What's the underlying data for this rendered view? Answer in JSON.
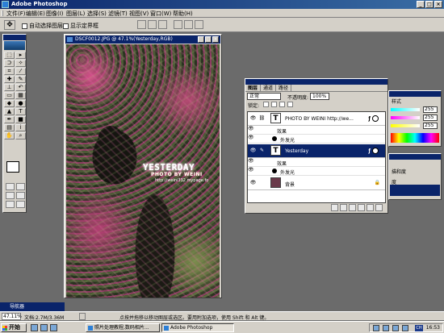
{
  "app": {
    "title": "Adobe Photoshop"
  },
  "menu": [
    "文件(F)",
    "编辑(E)",
    "图像(I)",
    "图层(L)",
    "选择(S)",
    "滤镜(T)",
    "视图(V)",
    "窗口(W)",
    "帮助(H)"
  ],
  "options": {
    "auto_select": "自动选择图层",
    "show_bounds": "显示定界框"
  },
  "document": {
    "title": "DSCF0012.JPG @ 47.1%(Yesterday,RGB)",
    "overlay_title": "YESTERDAY",
    "overlay_byline": "PHOTO BY WEINI",
    "overlay_url": "http://weini332.mypage.fo"
  },
  "layers_panel": {
    "tabs": [
      "图层",
      "通道",
      "路径"
    ],
    "blend_mode": "正常",
    "opacity_label": "不透明度:",
    "opacity_value": "100%",
    "lock_label": "锁定:",
    "layers": [
      {
        "name": "PHOTO  BY  WEINI http://we...",
        "effects_label": "效果",
        "effect": "外发光",
        "selected": false
      },
      {
        "name": "Yesterday",
        "effects_label": "效果",
        "effect": "外发光",
        "selected": true
      },
      {
        "name": "背景",
        "selected": false
      }
    ],
    "fx": "ƒ"
  },
  "styles_panel": {
    "tab": "样式",
    "values": [
      "255",
      "255",
      "255"
    ]
  },
  "swatch_panel": {
    "labels": [
      "描和度",
      "度"
    ]
  },
  "status": {
    "zoom": "47.11%",
    "doc_size": "文档:2.7M/3.36M",
    "hint": "点按并拖移以移动图层或选区。要用附加选项，使用 Shift 和 Alt 键。",
    "palette_bar": "导航器"
  },
  "taskbar": {
    "start": "开始",
    "tasks": [
      "照片处理教程,数码相片...",
      "Adobe Photoshop"
    ],
    "ime": "CH",
    "clock": "16:53"
  }
}
